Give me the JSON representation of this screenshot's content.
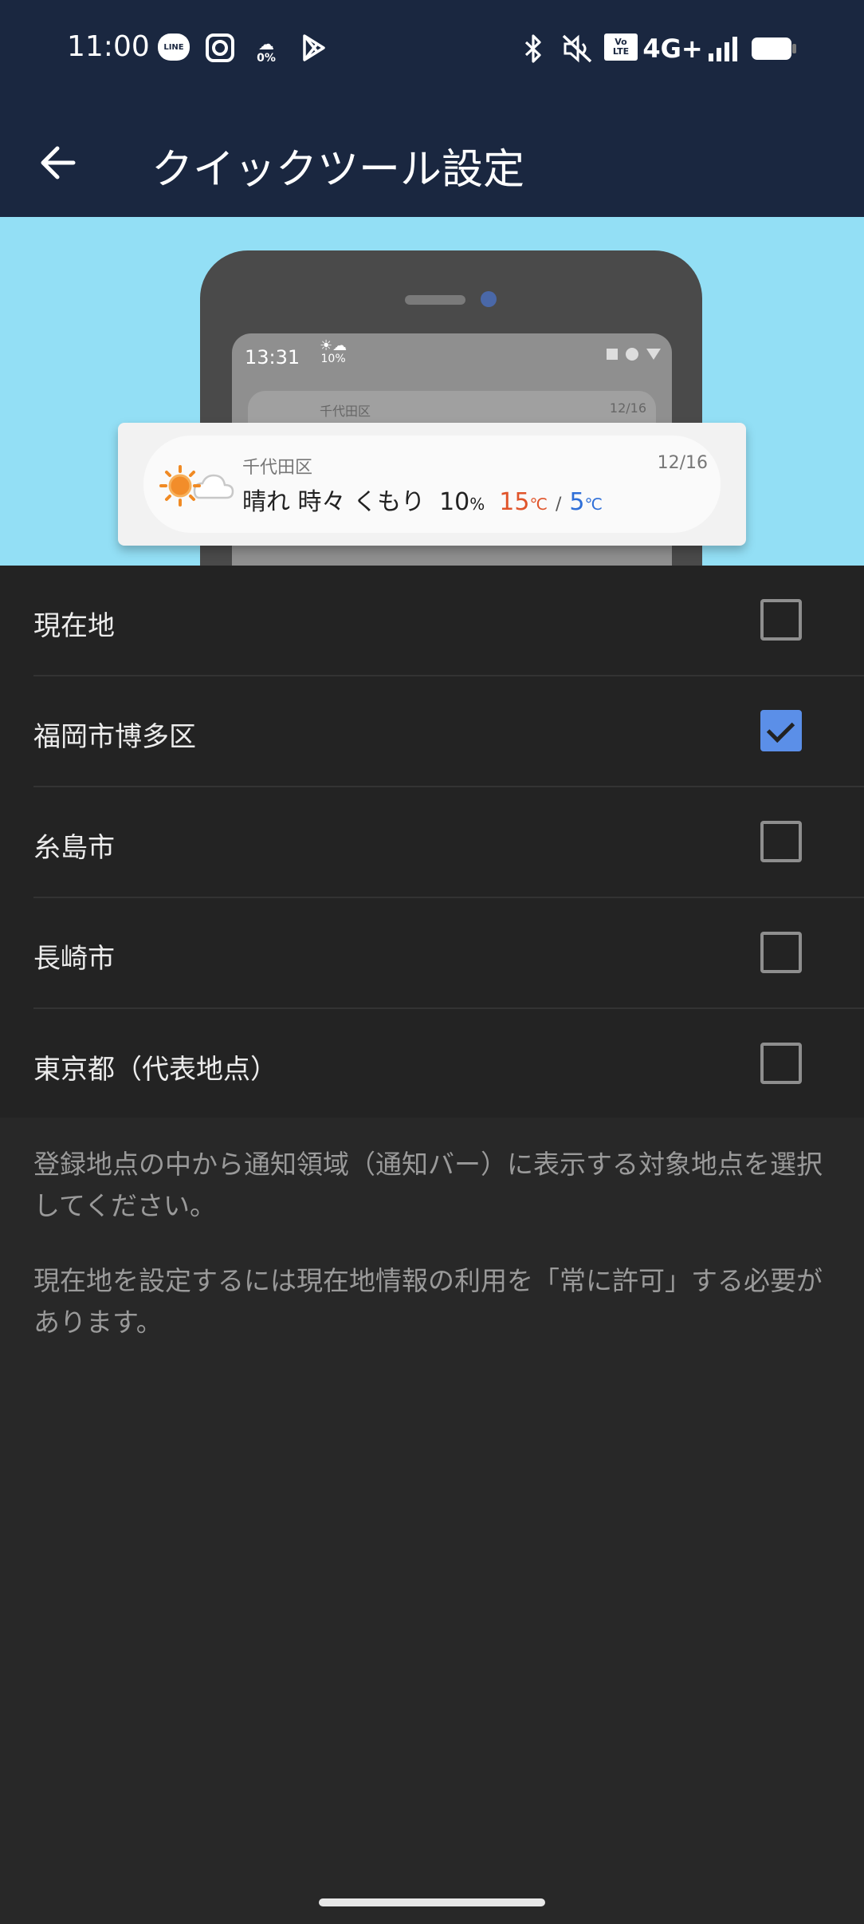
{
  "status_bar": {
    "time": "11:00",
    "line_label": "LINE",
    "weather_percent": "0%",
    "volte_top": "Vo",
    "volte_bottom": "LTE",
    "network": "4G+"
  },
  "app_bar": {
    "title": "クイックツール設定"
  },
  "preview": {
    "phone_time": "13:31",
    "phone_weather_percent": "10%",
    "ghost_location": "千代田区",
    "ghost_date": "12/16",
    "notification": {
      "location": "千代田区",
      "date": "12/16",
      "weather": "晴れ 時々 くもり",
      "precip_value": "10",
      "precip_unit": "%",
      "high_value": "15",
      "high_unit": "℃",
      "separator": "/",
      "low_value": "5",
      "low_unit": "℃"
    }
  },
  "locations": [
    {
      "label": "現在地",
      "checked": false
    },
    {
      "label": "福岡市博多区",
      "checked": true
    },
    {
      "label": "糸島市",
      "checked": false
    },
    {
      "label": "長崎市",
      "checked": false
    },
    {
      "label": "東京都（代表地点）",
      "checked": false
    }
  ],
  "notes": {
    "line1": "登録地点の中から通知領域（通知バー）に表示する対象地点を選択してください。",
    "line2": "現在地を設定するには現在地情報の利用を「常に許可」する必要があります。"
  },
  "colors": {
    "header_bg": "#1a2740",
    "preview_bg": "#93dff5",
    "list_bg": "#232323",
    "page_bg": "#282828",
    "checkbox_checked": "#5b8fe8",
    "temp_high": "#e0542a",
    "temp_low": "#2f6fd8"
  }
}
